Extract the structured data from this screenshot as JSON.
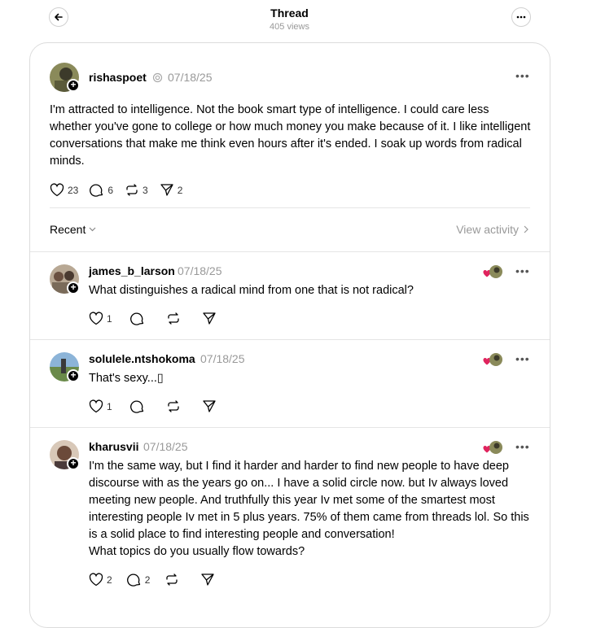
{
  "header": {
    "title": "Thread",
    "views": "405 views"
  },
  "post": {
    "username": "rishaspoet",
    "date": "07/18/25",
    "text": "I'm attracted to intelligence. Not the book smart type of intelligence. I could care less whether you've gone to college or how much money you make because of it. I like intelligent conversations that make me think even hours after it's ended. I soak up words from radical minds.",
    "likes": "23",
    "replies": "6",
    "reposts": "3",
    "shares": "2"
  },
  "sort": {
    "label": "Recent",
    "view_activity": "View activity"
  },
  "replies": [
    {
      "username": "james_b_larson",
      "date": "07/18/25",
      "text": "What distinguishes a radical mind from one that is not radical?",
      "likes": "1",
      "replies": "",
      "avatar_color": "#7a6b5a"
    },
    {
      "username": "solulele.ntshokoma",
      "date": "07/18/25",
      "text": "That's sexy...▯",
      "likes": "1",
      "replies": "",
      "avatar_color": "#5d7a8c"
    },
    {
      "username": "kharusvii",
      "date": "07/18/25",
      "text": "I'm the same way, but I find it harder and harder to find new people to have deep discourse with as the years go on... I have a solid circle now. but Iv always loved meeting new people. And truthfully this year Iv met some of the smartest most interesting people Iv met in 5 plus years. 75% of them came from threads lol. So this is a solid place to find interesting people and conversation!\nWhat topics do you usually flow towards?",
      "likes": "2",
      "replies": "2",
      "avatar_color": "#6b4a3a"
    }
  ],
  "colors": {
    "heart_red": "#e0245e",
    "muted": "#999999",
    "border": "#dcdcdc"
  }
}
